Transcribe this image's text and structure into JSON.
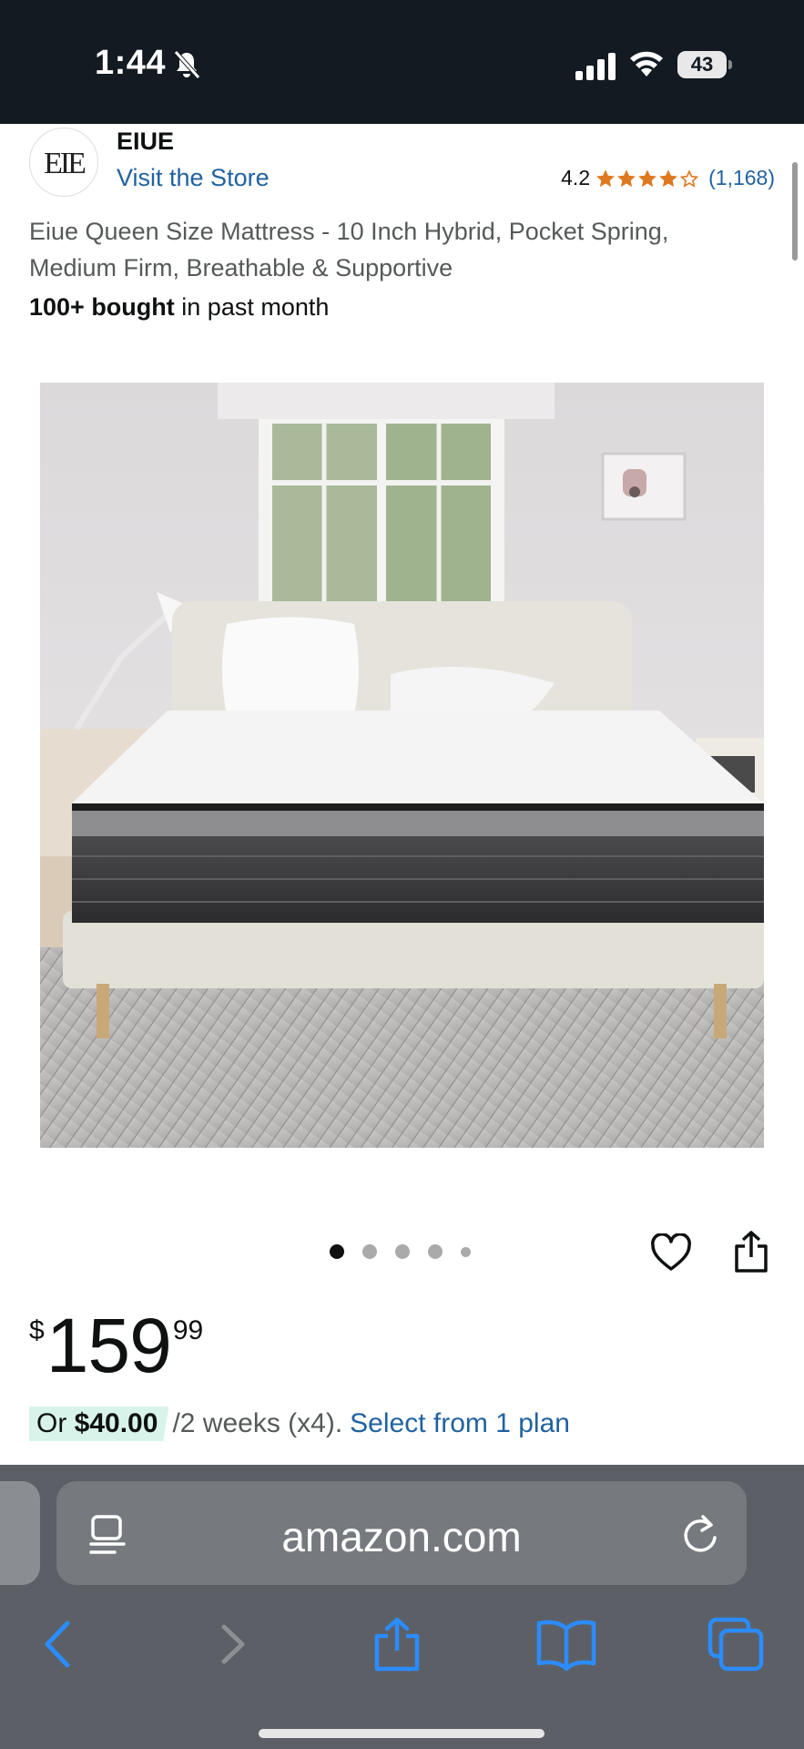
{
  "status_bar": {
    "time": "1:44",
    "battery": "43"
  },
  "brand": {
    "name": "EIUE",
    "visit_store": "Visit the Store",
    "logo_text": "EIUE"
  },
  "rating": {
    "value": "4.2",
    "stars": 4.2,
    "count": "(1,168)"
  },
  "product": {
    "title": "Eiue Queen Size Mattress - 10 Inch Hybrid, Pocket Spring, Medium Firm, Breathable & Supportive",
    "bought_bold": "100+ bought",
    "bought_rest": " in past month"
  },
  "carousel": {
    "count": 5,
    "active": 0
  },
  "price": {
    "symbol": "$",
    "whole": "159",
    "fraction": "99"
  },
  "installment": {
    "prefix": "Or ",
    "amount": "$40.00",
    "period": "/2 weeks (x4).",
    "link": "Select from 1 plan"
  },
  "browser": {
    "url": "amazon.com"
  },
  "icons": {
    "mute": "bell-slash-icon",
    "signal": "cellular-signal-icon",
    "wifi": "wifi-icon",
    "wishlist": "heart-icon",
    "share": "share-icon",
    "reader": "reader-mode-icon",
    "reload": "reload-icon",
    "back": "chevron-left-icon",
    "forward": "chevron-right-icon",
    "bookmarks": "book-icon",
    "tabs": "tabs-icon"
  },
  "colors": {
    "link": "#2162a1",
    "star": "#de7921",
    "status_bar_bg": "#131a22",
    "badge_bg": "#d8f4ea"
  }
}
